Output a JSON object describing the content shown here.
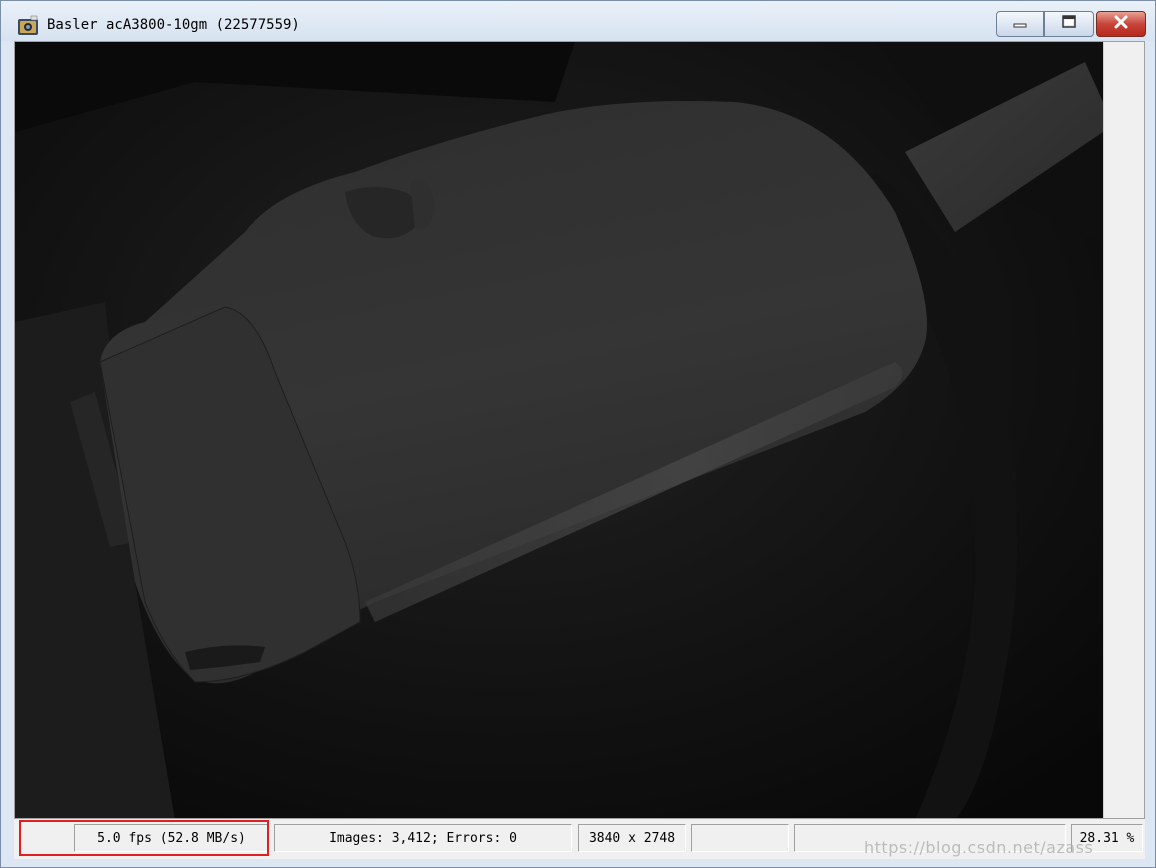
{
  "window": {
    "title": "Basler acA3800-10gm (22577559)",
    "icons": {
      "app": "camera-app-icon",
      "minimize": "minimize-icon",
      "maximize": "maximize-icon",
      "close": "close-icon"
    },
    "colors": {
      "close_button": "#c7453a",
      "highlight_border": "#e02020"
    }
  },
  "status_bar": {
    "frame_rate": "5.0 fps (52.8 MB/s)",
    "images_errors": "Images: 3,412; Errors: 0",
    "resolution": "3840 x 2748",
    "empty_1": "",
    "empty_2": "",
    "zoom": "28.31 %"
  },
  "watermark": {
    "text": "https://blog.csdn.net/azass"
  }
}
